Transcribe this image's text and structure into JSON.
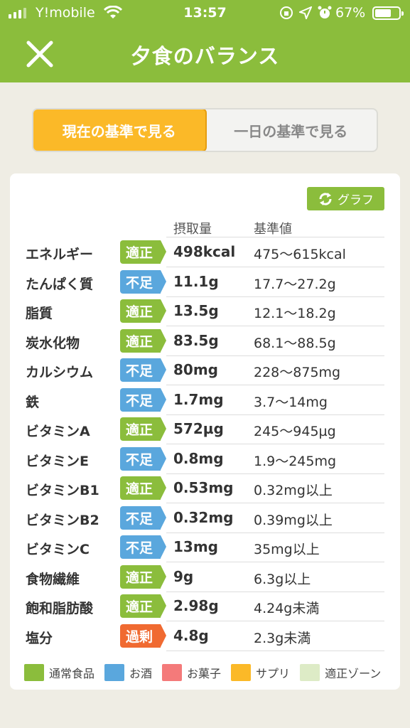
{
  "status_bar": {
    "carrier": "Y!mobile",
    "time": "13:57",
    "battery_percent": "67%"
  },
  "nav": {
    "title": "夕食のバランス"
  },
  "segment": {
    "options": [
      {
        "label": "現在の基準で見る",
        "selected": true
      },
      {
        "label": "一日の基準で見る",
        "selected": false
      }
    ]
  },
  "card": {
    "graph_button": "グラフ",
    "columns": {
      "intake": "摂取量",
      "standard": "基準値"
    },
    "status_colors": {
      "適正": "#8bbd3c",
      "不足": "#5aa7dd",
      "過剰": "#f06a31"
    },
    "rows": [
      {
        "name": "エネルギー",
        "status": "適正",
        "intake": "498kcal",
        "standard": "475～615kcal"
      },
      {
        "name": "たんぱく質",
        "status": "不足",
        "intake": "11.1g",
        "standard": "17.7～27.2g"
      },
      {
        "name": "脂質",
        "status": "適正",
        "intake": "13.5g",
        "standard": "12.1～18.2g"
      },
      {
        "name": "炭水化物",
        "status": "適正",
        "intake": "83.5g",
        "standard": "68.1～88.5g"
      },
      {
        "name": "カルシウム",
        "status": "不足",
        "intake": "80mg",
        "standard": "228～875mg"
      },
      {
        "name": "鉄",
        "status": "不足",
        "intake": "1.7mg",
        "standard": "3.7～14mg"
      },
      {
        "name": "ビタミンA",
        "status": "適正",
        "intake": "572µg",
        "standard": "245～945µg"
      },
      {
        "name": "ビタミンE",
        "status": "不足",
        "intake": "0.8mg",
        "standard": "1.9～245mg"
      },
      {
        "name": "ビタミンB1",
        "status": "適正",
        "intake": "0.53mg",
        "standard": "0.32mg以上"
      },
      {
        "name": "ビタミンB2",
        "status": "不足",
        "intake": "0.32mg",
        "standard": "0.39mg以上"
      },
      {
        "name": "ビタミンC",
        "status": "不足",
        "intake": "13mg",
        "standard": "35mg以上"
      },
      {
        "name": "食物繊維",
        "status": "適正",
        "intake": "9g",
        "standard": "6.3g以上"
      },
      {
        "name": "飽和脂肪酸",
        "status": "適正",
        "intake": "2.98g",
        "standard": "4.24g未満"
      },
      {
        "name": "塩分",
        "status": "過剰",
        "intake": "4.8g",
        "standard": "2.3g未満"
      }
    ],
    "legend": [
      {
        "label": "通常食品",
        "color": "#8bbd3c"
      },
      {
        "label": "お酒",
        "color": "#5aa7dd"
      },
      {
        "label": "お菓子",
        "color": "#f47a7a"
      },
      {
        "label": "サプリ",
        "color": "#fbb928"
      },
      {
        "label": "適正ゾーン",
        "color": "#ddebc6"
      }
    ]
  }
}
